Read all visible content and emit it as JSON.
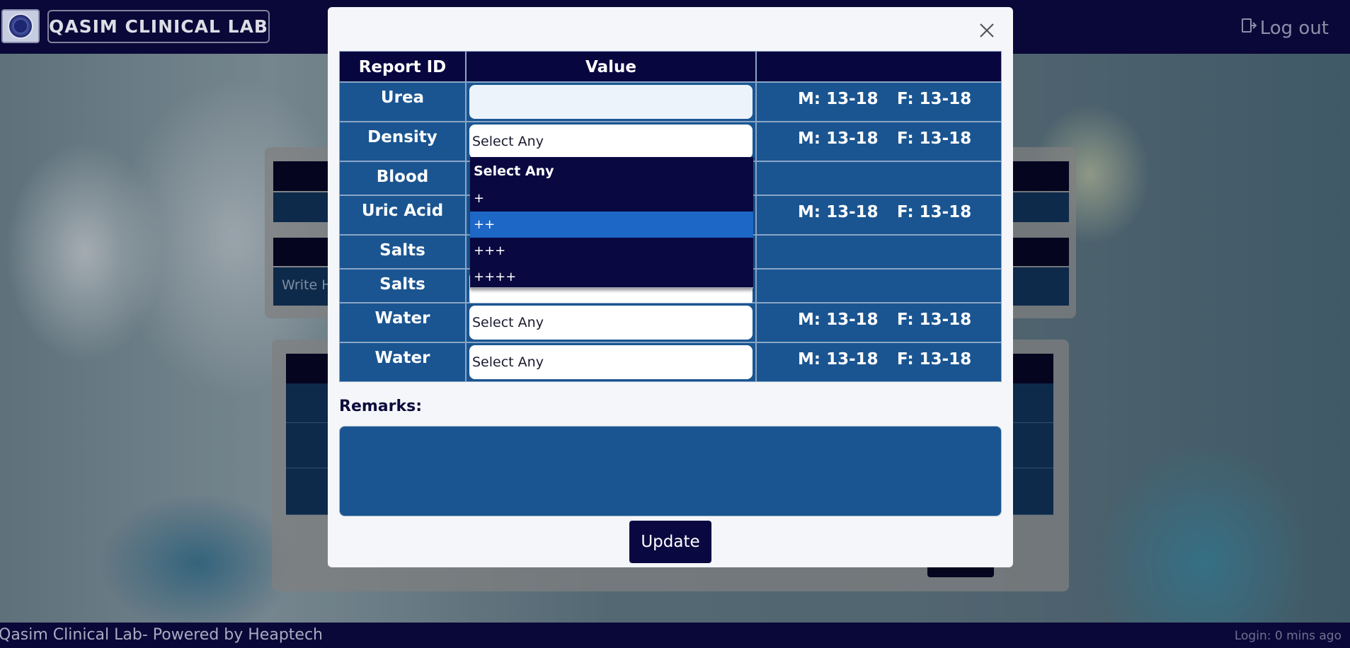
{
  "app": {
    "brand": "QASIM CLINICAL LAB",
    "logout_label": "Log out"
  },
  "background_card": {
    "placeholder": "Write H"
  },
  "modal": {
    "columns": [
      "Report ID",
      "Value",
      ""
    ],
    "rows": [
      {
        "report_id": "Urea",
        "field_type": "text",
        "value": "",
        "range_m": "M: 13-18",
        "range_f": "F: 13-18"
      },
      {
        "report_id": "Density",
        "field_type": "select",
        "value": "Select Any",
        "range_m": "M: 13-18",
        "range_f": "F: 13-18"
      },
      {
        "report_id": "Blood",
        "field_type": "select",
        "value": "",
        "range_m": "",
        "range_f": ""
      },
      {
        "report_id": "Uric Acid",
        "field_type": "select",
        "value": "",
        "range_m": "M: 13-18",
        "range_f": "F: 13-18"
      },
      {
        "report_id": "Salts",
        "field_type": "select",
        "value": "",
        "range_m": "",
        "range_f": ""
      },
      {
        "report_id": "Salts",
        "field_type": "select",
        "value": "",
        "range_m": "",
        "range_f": ""
      },
      {
        "report_id": "Water",
        "field_type": "select",
        "value": "Select Any",
        "range_m": "M: 13-18",
        "range_f": "F: 13-18"
      },
      {
        "report_id": "Water",
        "field_type": "select",
        "value": "Select Any",
        "range_m": "M: 13-18",
        "range_f": "F: 13-18"
      }
    ],
    "dropdown_options": [
      {
        "label": "Select Any",
        "header": true
      },
      {
        "label": "+"
      },
      {
        "label": "++",
        "highlighted": true
      },
      {
        "label": "+++"
      },
      {
        "label": "++++"
      }
    ],
    "remarks_label": "Remarks:",
    "remarks_value": "",
    "update_label": "Update"
  },
  "footer": {
    "left": "Qasim Clinical Lab- Powered by Heaptech",
    "right": "Login: 0 mins ago"
  },
  "colors": {
    "navy": "#0a0840",
    "cell_blue": "#1a5591",
    "highlight": "#1d67c7"
  }
}
